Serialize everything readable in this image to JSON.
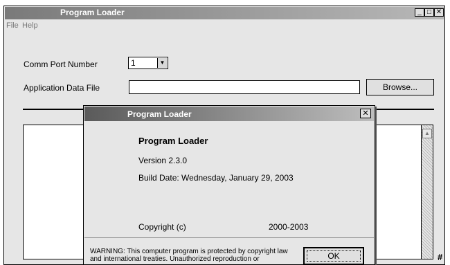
{
  "window": {
    "title": "Program Loader",
    "minimize_glyph": "_",
    "maximize_glyph": "□",
    "close_glyph": "✕"
  },
  "menu": {
    "items": [
      "File",
      "Help"
    ]
  },
  "form": {
    "comm_port_label": "Comm Port Number",
    "comm_port_value": "1",
    "app_data_file_label": "Application Data File",
    "app_data_file_value": "",
    "browse_label": "Browse..."
  },
  "log": {
    "side_glyph": "#"
  },
  "about_dialog": {
    "title": "Program Loader",
    "product_name": "Program Loader",
    "version": "Version 2.3.0",
    "build_date": "Build Date: Wednesday, January 29, 2003",
    "copyright": "Copyright (c)",
    "years": "2000-2003",
    "warning": "WARNING: This computer program is protected by copyright law and international treaties.  Unauthorized reproduction or",
    "ok_label": "OK",
    "close_glyph": "✕"
  },
  "colors": {
    "window_bg": "#e6e6e6",
    "titlebar_dark": "#5a5a5a",
    "titlebar_light": "#bdbdbd"
  }
}
